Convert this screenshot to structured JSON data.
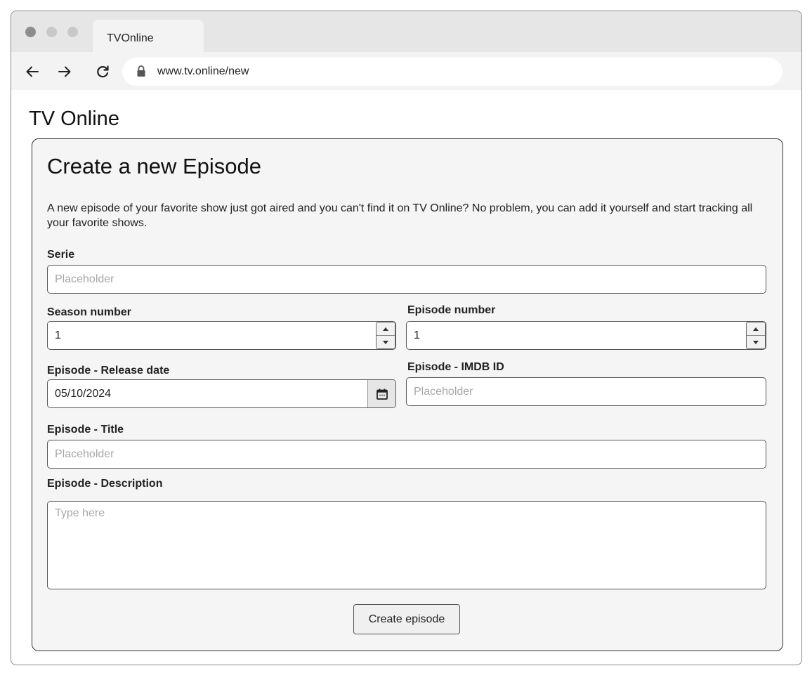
{
  "browser": {
    "tab_title": "TVOnline",
    "url": "www.tv.online/new"
  },
  "app": {
    "title": "TV Online"
  },
  "form": {
    "title": "Create a new Episode",
    "intro": "A new episode of your favorite show just got aired and you can't find it on TV Online? No problem, you can add it yourself and start tracking all your favorite shows.",
    "serie": {
      "label": "Serie",
      "placeholder": "Placeholder",
      "value": ""
    },
    "season_number": {
      "label": "Season number",
      "value": "1"
    },
    "episode_number": {
      "label": "Episode number",
      "value": "1"
    },
    "release_date": {
      "label": "Episode - Release date",
      "value": "05/10/2024"
    },
    "imdb_id": {
      "label": "Episode - IMDB ID",
      "placeholder": "Placeholder",
      "value": ""
    },
    "title_field": {
      "label": "Episode - Title",
      "placeholder": "Placeholder",
      "value": ""
    },
    "description": {
      "label": "Episode - Description",
      "placeholder": "Type here",
      "value": ""
    },
    "submit_label": "Create episode"
  },
  "icons": {
    "back": "arrow-left-icon",
    "forward": "arrow-right-icon",
    "reload": "reload-icon",
    "lock": "lock-icon",
    "calendar": "calendar-icon"
  }
}
